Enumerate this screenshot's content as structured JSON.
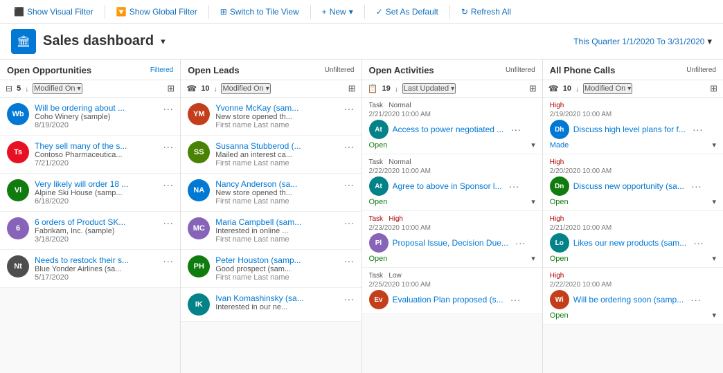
{
  "toolbar": {
    "buttons": [
      {
        "id": "show-visual-filter",
        "label": "Show Visual Filter",
        "icon": "⬛"
      },
      {
        "id": "show-global-filter",
        "label": "Show Global Filter",
        "icon": "🔽"
      },
      {
        "id": "switch-tile-view",
        "label": "Switch to Tile View",
        "icon": "⊞"
      },
      {
        "id": "new",
        "label": "New",
        "icon": "+"
      },
      {
        "id": "set-as-default",
        "label": "Set As Default",
        "icon": "✓"
      },
      {
        "id": "refresh-all",
        "label": "Refresh All",
        "icon": "↻"
      }
    ]
  },
  "header": {
    "app_icon": "🏛",
    "title": "Sales dashboard",
    "quarter": "This Quarter 1/1/2020 To 3/31/2020"
  },
  "panels": [
    {
      "id": "open-opportunities",
      "title": "Open Opportunities",
      "badge_type": "filtered",
      "badge_label": "Filtered",
      "count": 5,
      "sort_label": "Modified On",
      "items": [
        {
          "id": "opp1",
          "avatar_text": "Wb",
          "avatar_color": "#0078d4",
          "name": "Will be ordering about ...",
          "company": "Coho Winery (sample)",
          "date": "8/19/2020"
        },
        {
          "id": "opp2",
          "avatar_text": "Ts",
          "avatar_color": "#e81123",
          "name": "They sell many of the s...",
          "company": "Contoso Pharmaceutica...",
          "date": "7/21/2020"
        },
        {
          "id": "opp3",
          "avatar_text": "Vl",
          "avatar_color": "#107c10",
          "name": "Very likely will order 18 ...",
          "company": "Alpine Ski House (samp...",
          "date": "6/18/2020"
        },
        {
          "id": "opp4",
          "avatar_text": "6",
          "avatar_color": "#8764b8",
          "name": "6 orders of Product SK...",
          "company": "Fabrikam, Inc. (sample)",
          "date": "3/18/2020"
        },
        {
          "id": "opp5",
          "avatar_text": "Nt",
          "avatar_color": "#4e4e4e",
          "name": "Needs to restock their s...",
          "company": "Blue Yonder Airlines (sa...",
          "date": "5/17/2020"
        }
      ]
    },
    {
      "id": "open-leads",
      "title": "Open Leads",
      "badge_type": "unfiltered",
      "badge_label": "Unfiltered",
      "count": 10,
      "sort_label": "Modified On",
      "items": [
        {
          "id": "lead1",
          "avatar_text": "YM",
          "avatar_color": "#c43e1c",
          "name": "Yvonne McKay (sam...",
          "sub": "New store opened th...",
          "label": "First name Last name"
        },
        {
          "id": "lead2",
          "avatar_text": "SS",
          "avatar_color": "#498205",
          "name": "Susanna Stubberod (...",
          "sub": "Mailed an interest ca...",
          "label": "First name Last name"
        },
        {
          "id": "lead3",
          "avatar_text": "NA",
          "avatar_color": "#0078d4",
          "name": "Nancy Anderson (sa...",
          "sub": "New store opened th...",
          "label": "First name Last name"
        },
        {
          "id": "lead4",
          "avatar_text": "MC",
          "avatar_color": "#8764b8",
          "name": "Maria Campbell (sam...",
          "sub": "Interested in online ...",
          "label": "First name Last name"
        },
        {
          "id": "lead5",
          "avatar_text": "PH",
          "avatar_color": "#107c10",
          "name": "Peter Houston (samp...",
          "sub": "Good prospect (sam...",
          "label": "First name Last name"
        },
        {
          "id": "lead6",
          "avatar_text": "IK",
          "avatar_color": "#038387",
          "name": "Ivan Komashinsky (sa...",
          "sub": "Interested in our ne...",
          "label": ""
        }
      ]
    },
    {
      "id": "open-activities",
      "title": "Open Activities",
      "badge_type": "unfiltered",
      "badge_label": "Unfiltered",
      "count": 19,
      "sort_label": "Last Updated",
      "items": [
        {
          "id": "act1",
          "avatar_text": "At",
          "avatar_color": "#038387",
          "type": "Task",
          "priority": "Normal",
          "datetime": "2/21/2020 10:00 AM",
          "title": "Access to power negotiated ...",
          "status": "Open",
          "status_type": "open"
        },
        {
          "id": "act2",
          "avatar_text": "At",
          "avatar_color": "#038387",
          "type": "Task",
          "priority": "Normal",
          "datetime": "2/22/2020 10:00 AM",
          "title": "Agree to above in Sponsor l...",
          "status": "Open",
          "status_type": "open"
        },
        {
          "id": "act3",
          "avatar_text": "Pl",
          "avatar_color": "#8764b8",
          "type": "Task",
          "priority": "High",
          "datetime": "2/23/2020 10:00 AM",
          "title": "Proposal Issue, Decision Due...",
          "status": "Open",
          "status_type": "open"
        },
        {
          "id": "act4",
          "avatar_text": "Ev",
          "avatar_color": "#c43e1c",
          "type": "Task",
          "priority": "Low",
          "datetime": "2/25/2020 10:00 AM",
          "title": "Evaluation Plan proposed (s...",
          "status": "Open",
          "status_type": "open"
        }
      ]
    },
    {
      "id": "all-phone-calls",
      "title": "All Phone Calls",
      "badge_type": "unfiltered",
      "badge_label": "Unfiltered",
      "count": 10,
      "sort_label": "Modified On",
      "items": [
        {
          "id": "pc1",
          "avatar_text": "Dh",
          "avatar_color": "#0078d4",
          "priority": "High",
          "datetime": "2/19/2020 10:00 AM",
          "title": "Discuss high level plans for f...",
          "status": "Made",
          "status_type": "made"
        },
        {
          "id": "pc2",
          "avatar_text": "Dn",
          "avatar_color": "#107c10",
          "priority": "High",
          "datetime": "2/20/2020 10:00 AM",
          "title": "Discuss new opportunity (sa...",
          "status": "Open",
          "status_type": "open"
        },
        {
          "id": "pc3",
          "avatar_text": "Lo",
          "avatar_color": "#038387",
          "priority": "High",
          "datetime": "2/21/2020 10:00 AM",
          "title": "Likes our new products (sam...",
          "status": "Open",
          "status_type": "open"
        },
        {
          "id": "pc4",
          "avatar_text": "Wi",
          "avatar_color": "#c43e1c",
          "priority": "High",
          "datetime": "2/22/2020 10:00 AM",
          "title": "Will be ordering soon (samp...",
          "status": "Open",
          "status_type": "open"
        }
      ]
    }
  ]
}
